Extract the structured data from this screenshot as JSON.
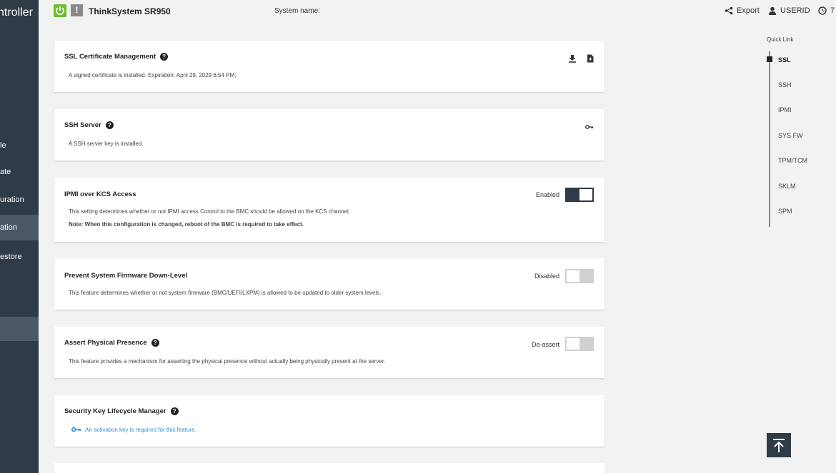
{
  "sidebar": {
    "brand": "ntroller",
    "items": [
      {
        "label": "le",
        "active": false
      },
      {
        "label": "ate",
        "active": false
      },
      {
        "label": "uration",
        "active": false
      },
      {
        "label": "ation",
        "active": true
      },
      {
        "label": "estore",
        "active": false
      }
    ]
  },
  "header": {
    "product": "ThinkSystem SR950",
    "system_name_label": "System name:",
    "export_label": "Export",
    "user_label": "USERID",
    "clock_value": "7"
  },
  "cards": {
    "ssl": {
      "title": "SSL Certificate Management",
      "desc": "A signed certificate is installed. Expiration: April 29, 2029 6:54 PM;"
    },
    "ssh": {
      "title": "SSH Server",
      "desc": "A SSH server key is installed."
    },
    "ipmi": {
      "title": "IPMI over KCS Access",
      "desc": "This setting determines whether or not IPMI access Control to the BMC should be allowed on the KCS channel.",
      "note": "Note: When this configuration is changed, reboot of the BMC is required to take effect.",
      "toggle_label": "Enabled",
      "toggle_on": true
    },
    "fw": {
      "title": "Prevent System Firmware Down-Level",
      "desc": "This feature determines whether or not system firmware (BMC/UEFI/LXPM) is allowed to be updated to older system levels.",
      "toggle_label": "Disabled",
      "toggle_on": false
    },
    "presence": {
      "title": "Assert Physical Presence",
      "desc": "This feature provides a mechanism for asserting the physical presence without actually being physically present at the server.",
      "toggle_label": "De-assert",
      "toggle_on": false
    },
    "sklm": {
      "title": "Security Key Lifecycle Manager",
      "link": "An activation key is required for this feature."
    }
  },
  "quick_link": {
    "title": "Quick Link",
    "items": [
      "SSL",
      "SSH",
      "IPMI",
      "SYS FW",
      "TPM/TCM",
      "SKLM",
      "SPM"
    ],
    "active": "SSL"
  },
  "colors": {
    "sidebar_bg": "#2f3b47",
    "power_green": "#6abf2e",
    "link_blue": "#2a8fd6"
  }
}
